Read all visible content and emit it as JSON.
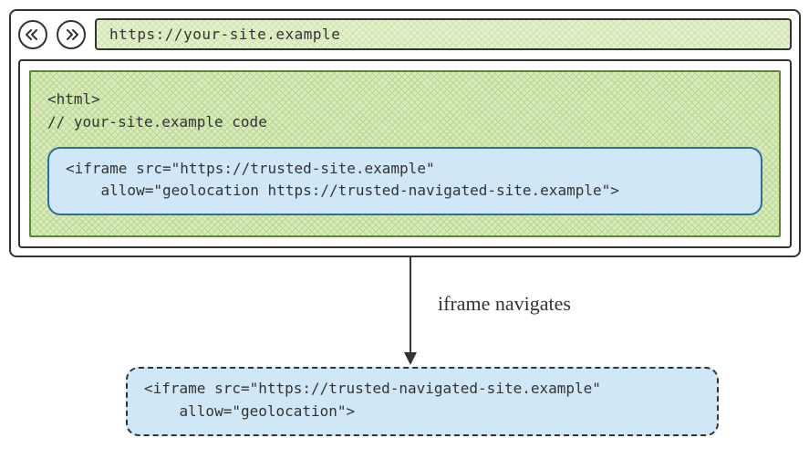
{
  "address_bar": "https://your-site.example",
  "page_code": {
    "line1": "<html>",
    "line2": "// your-site.example code"
  },
  "iframe1": {
    "line1": "<iframe src=\"https://trusted-site.example\"",
    "line2": "    allow=\"geolocation https://trusted-navigated-site.example\">"
  },
  "arrow_label": "iframe navigates",
  "iframe2": {
    "line1": "<iframe src=\"https://trusted-navigated-site.example\"",
    "line2": "    allow=\"geolocation\">"
  },
  "chart_data": {
    "type": "diagram",
    "description": "Browser window showing a parent page (your-site.example) embedding an iframe with geolocation permission scoped to trusted-navigated-site.example; arrow labeled 'iframe navigates' points to the iframe's new state after navigation.",
    "nodes": [
      {
        "id": "parent-page",
        "url": "https://your-site.example"
      },
      {
        "id": "iframe-initial",
        "src": "https://trusted-site.example",
        "allow": "geolocation https://trusted-navigated-site.example"
      },
      {
        "id": "iframe-navigated",
        "src": "https://trusted-navigated-site.example",
        "allow": "geolocation"
      }
    ],
    "edges": [
      {
        "from": "iframe-initial",
        "to": "iframe-navigated",
        "label": "iframe navigates"
      }
    ]
  }
}
